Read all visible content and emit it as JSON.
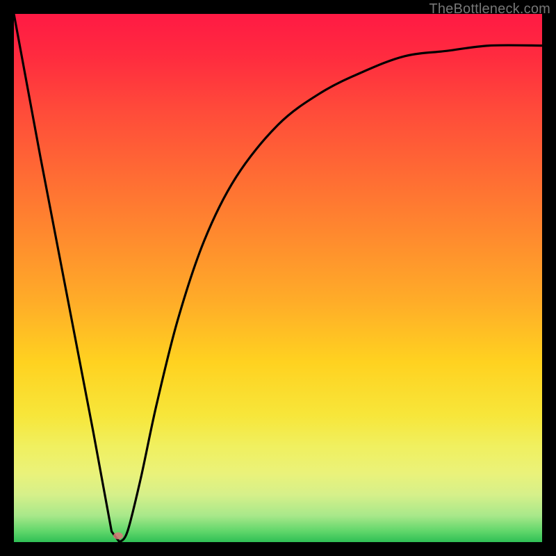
{
  "watermark": "TheBottleneck.com",
  "marker": {
    "x_frac": 0.198,
    "y_frac": 0.988
  },
  "chart_data": {
    "type": "line",
    "title": "",
    "xlabel": "",
    "ylabel": "",
    "xlim": [
      0,
      1
    ],
    "ylim": [
      0,
      1
    ],
    "series": [
      {
        "name": "bottleneck-curve",
        "x": [
          0.0,
          0.05,
          0.1,
          0.15,
          0.185,
          0.2,
          0.215,
          0.24,
          0.27,
          0.31,
          0.36,
          0.42,
          0.5,
          0.58,
          0.66,
          0.74,
          0.82,
          0.9,
          1.0
        ],
        "y": [
          1.0,
          0.73,
          0.47,
          0.21,
          0.02,
          0.0,
          0.02,
          0.12,
          0.26,
          0.42,
          0.57,
          0.69,
          0.79,
          0.85,
          0.89,
          0.92,
          0.93,
          0.94,
          0.94
        ]
      }
    ],
    "annotations": [
      {
        "type": "point",
        "name": "optimal-marker",
        "x": 0.198,
        "y": 0.0
      }
    ],
    "background_gradient": {
      "direction": "vertical",
      "stops": [
        {
          "pos": 0.0,
          "color": "#ff1a44"
        },
        {
          "pos": 0.3,
          "color": "#ff6a34"
        },
        {
          "pos": 0.55,
          "color": "#ffae28"
        },
        {
          "pos": 0.8,
          "color": "#f0f060"
        },
        {
          "pos": 1.0,
          "color": "#2fbf55"
        }
      ]
    }
  }
}
